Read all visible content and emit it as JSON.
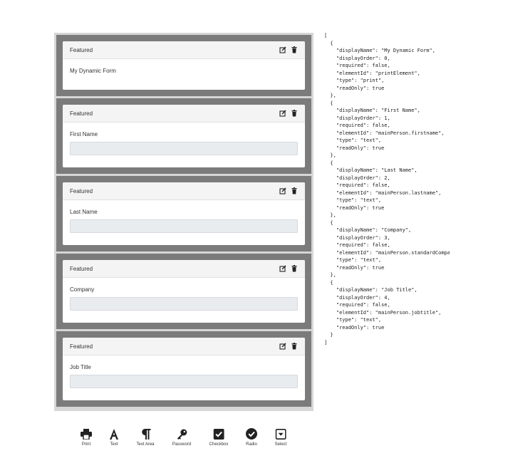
{
  "builder": {
    "cards": [
      {
        "header": "Featured",
        "label": "My Dynamic Form",
        "has_input": false
      },
      {
        "header": "Featured",
        "label": "First Name",
        "has_input": true
      },
      {
        "header": "Featured",
        "label": "Last Name",
        "has_input": true
      },
      {
        "header": "Featured",
        "label": "Company",
        "has_input": true
      },
      {
        "header": "Featured",
        "label": "Job Title",
        "has_input": true
      }
    ]
  },
  "json_output": "[\n  {\n    \"displayName\": \"My Dynamic Form\",\n    \"displayOrder\": 0,\n    \"required\": false,\n    \"elementId\": \"printElement\",\n    \"type\": \"print\",\n    \"readOnly\": true\n  },\n  {\n    \"displayName\": \"First Name\",\n    \"displayOrder\": 1,\n    \"required\": false,\n    \"elementId\": \"mainPerson.firstname\",\n    \"type\": \"text\",\n    \"readOnly\": true\n  },\n  {\n    \"displayName\": \"Last Name\",\n    \"displayOrder\": 2,\n    \"required\": false,\n    \"elementId\": \"mainPerson.lastname\",\n    \"type\": \"text\",\n    \"readOnly\": true\n  },\n  {\n    \"displayName\": \"Company\",\n    \"displayOrder\": 3,\n    \"required\": false,\n    \"elementId\": \"mainPerson.standardCompa\n    \"type\": \"text\",\n    \"readOnly\": true\n  },\n  {\n    \"displayName\": \"Job Title\",\n    \"displayOrder\": 4,\n    \"required\": false,\n    \"elementId\": \"mainPerson.jobtitle\",\n    \"type\": \"text\",\n    \"readOnly\": true\n  }\n]",
  "toolbox": {
    "print": "Print",
    "text": "Text",
    "textarea": "Text Area",
    "password": "Password",
    "checkbox": "Checkbox",
    "radio": "Radio",
    "select": "Select"
  },
  "colors": {
    "slot_bg": "#7b7b7b",
    "builder_bg": "#d6d6d6",
    "input_bg": "#e9ecef"
  }
}
